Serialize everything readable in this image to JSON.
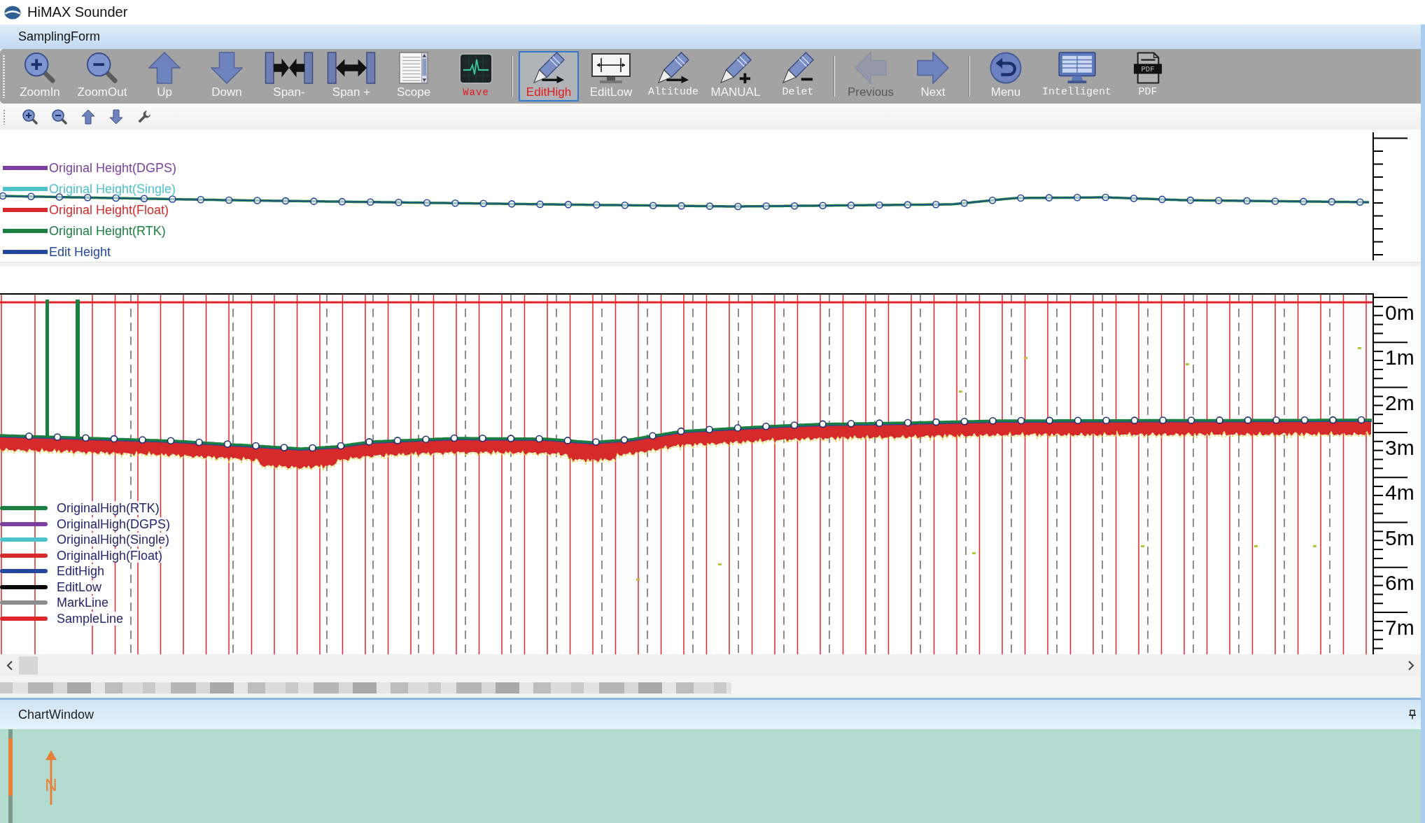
{
  "window": {
    "title": "HiMAX Sounder"
  },
  "form": {
    "title": "SamplingForm"
  },
  "toolbar": {
    "groups": [
      {
        "buttons": [
          {
            "label": "ZoomIn",
            "kind": "zoomin",
            "selected": false,
            "disabled": false
          },
          {
            "label": "ZoomOut",
            "kind": "zoomout",
            "selected": false,
            "disabled": false
          },
          {
            "label": "Up",
            "kind": "up",
            "selected": false,
            "disabled": false
          },
          {
            "label": "Down",
            "kind": "down",
            "selected": false,
            "disabled": false
          },
          {
            "label": "Span-",
            "kind": "spanminus",
            "selected": false,
            "disabled": false
          },
          {
            "label": "Span +",
            "kind": "spanplus",
            "selected": false,
            "disabled": false
          },
          {
            "label": "Scope",
            "kind": "scope",
            "selected": false,
            "disabled": false
          },
          {
            "label": "Wave",
            "kind": "wave",
            "selected": false,
            "disabled": false
          }
        ]
      },
      {
        "buttons": [
          {
            "label": "EditHigh",
            "kind": "edithigh",
            "selected": true,
            "disabled": false
          },
          {
            "label": "EditLow",
            "kind": "editlow",
            "selected": false,
            "disabled": false
          },
          {
            "label": "Altitude",
            "kind": "altitude",
            "selected": false,
            "disabled": false
          },
          {
            "label": "MANUAL",
            "kind": "manual",
            "selected": false,
            "disabled": false
          },
          {
            "label": "Delet",
            "kind": "delete",
            "selected": false,
            "disabled": false
          }
        ]
      },
      {
        "buttons": [
          {
            "label": "Previous",
            "kind": "previous",
            "selected": false,
            "disabled": true
          },
          {
            "label": "Next",
            "kind": "next",
            "selected": false,
            "disabled": false
          }
        ]
      },
      {
        "buttons": [
          {
            "label": "Menu",
            "kind": "menu",
            "selected": false,
            "disabled": false
          },
          {
            "label": "Intelligent",
            "kind": "intelligent",
            "selected": false,
            "disabled": false
          },
          {
            "label": "PDF",
            "kind": "pdf",
            "icon_text": "PDF",
            "selected": false,
            "disabled": false
          }
        ]
      }
    ]
  },
  "height_chart": {
    "legend": [
      {
        "label": "Original Height(DGPS)",
        "color": "#7b3f9e"
      },
      {
        "label": "Original Height(Single)",
        "color": "#4ec2cb"
      },
      {
        "label": "Original Height(Float)",
        "color": "#d62a2a"
      },
      {
        "label": "Original Height(RTK)",
        "color": "#1b7f3f"
      },
      {
        "label": "Edit Height",
        "color": "#24479c"
      }
    ]
  },
  "depth_chart": {
    "legend": [
      {
        "label": "OriginalHigh(RTK)",
        "color": "#1b7f3f"
      },
      {
        "label": "OriginalHigh(DGPS)",
        "color": "#7b3f9e"
      },
      {
        "label": "OriginalHigh(Single)",
        "color": "#4ec2cb"
      },
      {
        "label": "OriginalHigh(Float)",
        "color": "#d62a2a"
      },
      {
        "label": "EditHigh",
        "color": "#24479c"
      },
      {
        "label": "EditLow",
        "color": "#0a0a0a"
      },
      {
        "label": "MarkLine",
        "color": "#8c8c8c"
      },
      {
        "label": "SampleLine",
        "color": "#e0262a"
      }
    ],
    "axis_labels": [
      "0m",
      "1m",
      "2m",
      "3m",
      "4m",
      "5m",
      "6m",
      "7m"
    ]
  },
  "chart_window": {
    "title": "ChartWindow",
    "compass_letter": "N"
  }
}
